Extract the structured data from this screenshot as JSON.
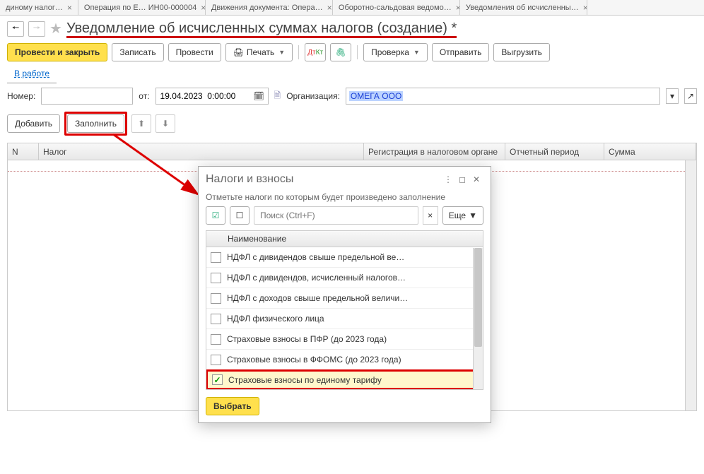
{
  "tabs": [
    {
      "label": "диному налог…"
    },
    {
      "label": "Операция по Е…  ИН00-000004"
    },
    {
      "label": "Движения документа: Опера…"
    },
    {
      "label": "Оборотно-сальдовая ведомо…"
    },
    {
      "label": "Уведомления об исчисленны…"
    }
  ],
  "title": "Уведомление об исчисленных суммах налогов (создание) *",
  "toolbar": {
    "post_close": "Провести и закрыть",
    "save": "Записать",
    "post": "Провести",
    "print": "Печать",
    "dtkt": "Дт/Кт",
    "check": "Проверка",
    "send": "Отправить",
    "export": "Выгрузить"
  },
  "status_link": "В работе",
  "form": {
    "num_label": "Номер:",
    "num_value": "",
    "date_label": "от:",
    "date_value": "19.04.2023  0:00:00",
    "org_label": "Организация:",
    "org_value": "ОМЕГА ООО"
  },
  "actions": {
    "add": "Добавить",
    "fill": "Заполнить"
  },
  "columns": {
    "n": "N",
    "tax": "Налог",
    "reg": "Регистрация в налоговом органе",
    "period": "Отчетный период",
    "sum": "Сумма"
  },
  "modal": {
    "title": "Налоги и взносы",
    "note": "Отметьте налоги по которым будет произведено заполнение",
    "search_ph": "Поиск (Ctrl+F)",
    "more": "Еще",
    "col": "Наименование",
    "items": [
      {
        "checked": false,
        "label": "НДФЛ с дивидендов свыше предельной ве…"
      },
      {
        "checked": false,
        "label": "НДФЛ с дивидендов, исчисленный налогов…"
      },
      {
        "checked": false,
        "label": "НДФЛ с доходов свыше предельной величи…"
      },
      {
        "checked": false,
        "label": "НДФЛ физического лица"
      },
      {
        "checked": false,
        "label": "Страховые взносы в ПФР (до 2023 года)"
      },
      {
        "checked": false,
        "label": "Страховые взносы в ФФОМС (до 2023 года)"
      },
      {
        "checked": true,
        "label": "Страховые взносы по единому тарифу"
      }
    ],
    "select": "Выбрать"
  }
}
